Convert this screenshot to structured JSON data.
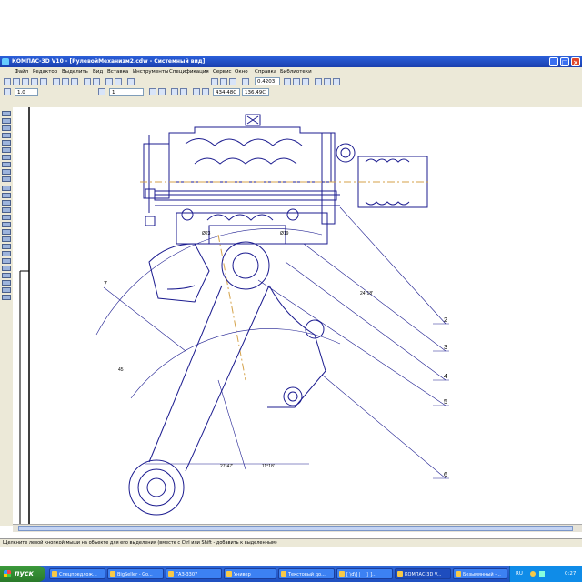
{
  "window": {
    "title": "КОМПАС-3D V10 - [РулевойМеханизм2.cdw - Системный вид]",
    "controls": {
      "minimize": "_",
      "maximize": "□",
      "close": "×"
    }
  },
  "menu": [
    "Файл",
    "Редактор",
    "Выделить",
    "Вид",
    "Вставка",
    "Инструменты",
    "Спецификация",
    "Сервис",
    "Окно",
    "Справка",
    "Библиотеки"
  ],
  "toolbar": {
    "zoom_value": "0.4203",
    "scale_value": "1.0",
    "layer_value": "1",
    "coord_x": "434.48С",
    "coord_y": "136.49С"
  },
  "drawing": {
    "labels": [
      "2",
      "3",
      "4",
      "5",
      "6",
      "7"
    ],
    "dimensions": [
      "27°47'",
      "11°18'",
      "24°18'",
      "45",
      "Ø23",
      "Ø19"
    ]
  },
  "status": {
    "hint": "Щелкните левой кнопкой мыши на объекте для его выделения (вместе с Ctrl или Shift - добавить к выделенным)"
  },
  "taskbar": {
    "start": "пуск",
    "tasks": [
      "Спецпредлож...",
      "BigSeller - Go...",
      "ГАЗ-3307",
      "Универ",
      "Текстовый до...",
      "[ \\d\\] | _ [| ]...",
      "КОМПАС-3D V...",
      "Безымянный -..."
    ],
    "tray_lang": "RU",
    "clock": "0:27"
  },
  "colors": {
    "title_bar": "#2b5fd9",
    "drawing_line": "#1b1b8f",
    "axis": "#d4a24a"
  }
}
